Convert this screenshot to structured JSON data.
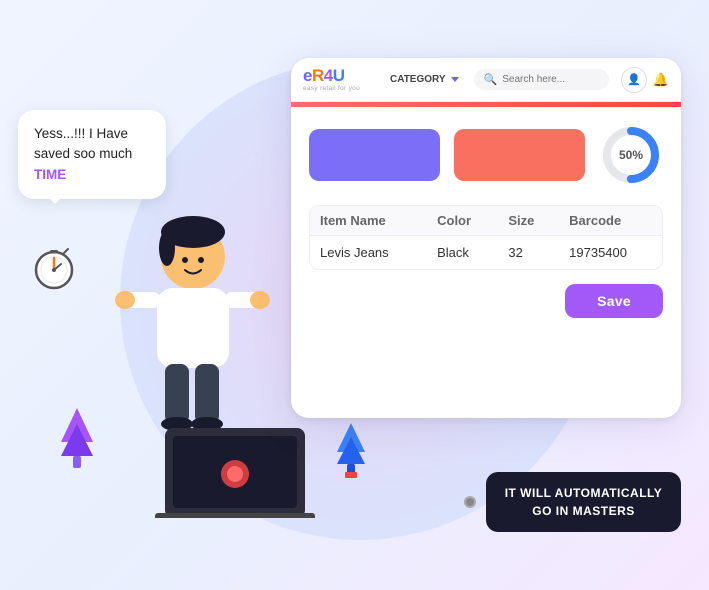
{
  "app": {
    "logo": {
      "e": "e",
      "r": "R",
      "four": "4",
      "u": "U",
      "sub": "easy retail for you"
    }
  },
  "speech_bubble": {
    "text": "Yess...!!! I Have saved soo much ",
    "highlight": "TIME"
  },
  "browser": {
    "nav": {
      "category_label": "CATEGORY",
      "search_placeholder": "Search here..."
    },
    "swatches": {
      "donut_percent": "50%"
    },
    "table": {
      "headers": [
        "Item Name",
        "Color",
        "Size",
        "Barcode"
      ],
      "rows": [
        [
          "Levis Jeans",
          "Black",
          "32",
          "19735400"
        ]
      ]
    },
    "save_button": "Save"
  },
  "auto_label": {
    "line1": "IT WILL AUTOMATICALLY",
    "line2": "GO IN MASTERS"
  }
}
